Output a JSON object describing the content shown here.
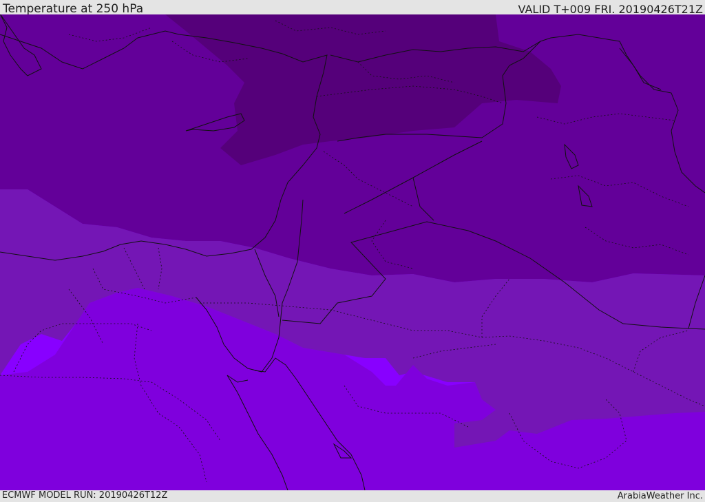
{
  "header": {
    "title": "Temperature at 250 hPa",
    "valid": "VALID T+009 FRI. 20190426T21Z"
  },
  "footer": {
    "model_run": "ECMWF MODEL RUN: 20190426T12Z",
    "credit": "ArabiaWeather Inc."
  },
  "colors": {
    "band_coldest": "#55007a",
    "band_cold": "#630099",
    "band_mid": "#7416b5",
    "band_warm": "#7f00dd",
    "band_warmest": "#8800ff",
    "background": "#e4e4e4"
  }
}
